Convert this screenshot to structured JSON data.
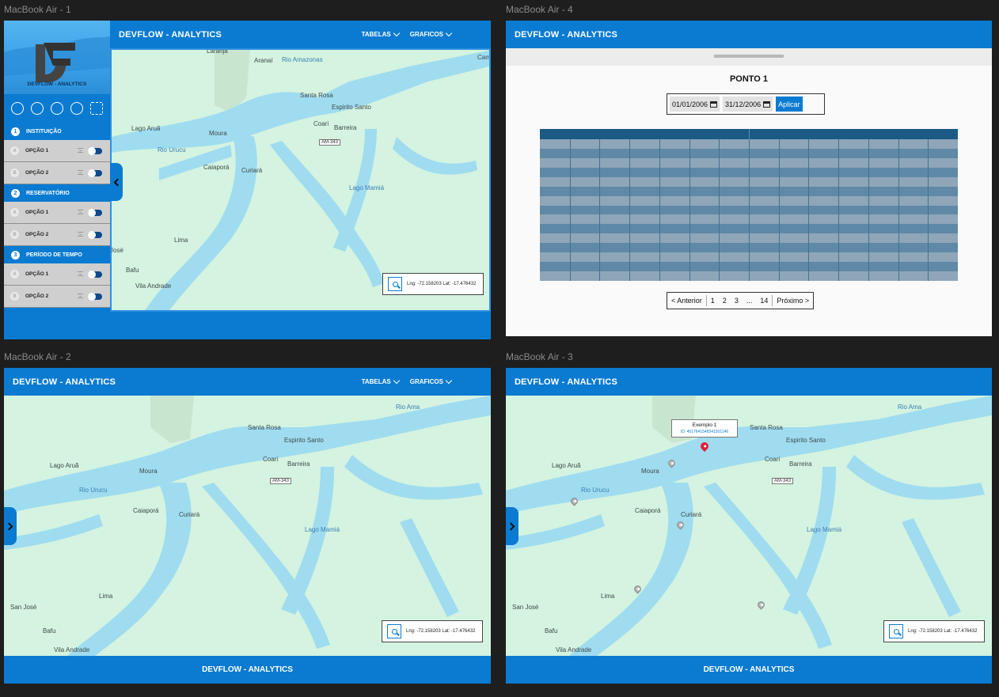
{
  "frames": {
    "f1": "MacBook Air - 1",
    "f2": "MacBook Air - 2",
    "f3": "MacBook Air - 3",
    "f4": "MacBook Air - 4"
  },
  "app": {
    "title": "DEVFLOW - ANALYTICS",
    "brand": "DEVFLOW - ANALYTICS",
    "footer": "DEVFLOW - ANALYTICS"
  },
  "menus": {
    "tabelas": "TABELAS",
    "graficos": "GRAFICOS"
  },
  "sidebar": {
    "sections": [
      {
        "num": "1",
        "label": "INSTITUIÇÃO",
        "options": [
          {
            "letter": "A",
            "label": "OPÇÃO 1"
          },
          {
            "letter": "B",
            "label": "OPÇÃO 2"
          }
        ]
      },
      {
        "num": "2",
        "label": "RESERVATÓRIO",
        "options": [
          {
            "letter": "A",
            "label": "OPÇÃO 1"
          },
          {
            "letter": "B",
            "label": "OPÇÃO 2"
          }
        ]
      },
      {
        "num": "3",
        "label": "PERÍODO DE TEMPO",
        "options": [
          {
            "letter": "A",
            "label": "OPÇÃO 1"
          },
          {
            "letter": "B",
            "label": "OPÇÃO 2"
          }
        ]
      }
    ]
  },
  "map": {
    "coords": "Lng: -72.158203 Lat: -17.476432",
    "places": {
      "laranja": "Laranja",
      "aranai": "Aranaí",
      "rio_amazonas": "Rio Amazonas",
      "cam": "Cam",
      "santa_rosa": "Santa Rosa",
      "espirito_santo": "Espirito Santo",
      "coari": "Coari",
      "barreira": "Barreira",
      "road": "AM-343",
      "lago_arua": "Lago Aruã",
      "moura": "Moura",
      "rio_urucu": "Rio Urucu",
      "caiapora": "Caiaporá",
      "curiara": "Curiará",
      "lago_mamia": "Lago Mamiá",
      "lima": "Lima",
      "jose": "José",
      "san_jose": "San José",
      "bafu": "Bafu",
      "vila_andrade": "Vila Andrade",
      "rio_ama_trunc": "Rio Ama"
    }
  },
  "popup": {
    "title": "Exemplo 1",
    "id": "ID: 4517641548341501146"
  },
  "table_view": {
    "point_title": "PONTO 1",
    "date_start": "01/01/2006",
    "date_end": "31/12/2006",
    "apply": "Aplicar",
    "pager": {
      "prev": "< Anterior",
      "p1": "1",
      "p2": "2",
      "p3": "3",
      "ellipsis": "...",
      "last": "14",
      "next": "Próximo >"
    }
  },
  "colors": {
    "brand_blue": "#0a7bd1",
    "land": "#d4f3e0",
    "water": "#9fdcf0",
    "table_dark": "#1f6592"
  }
}
